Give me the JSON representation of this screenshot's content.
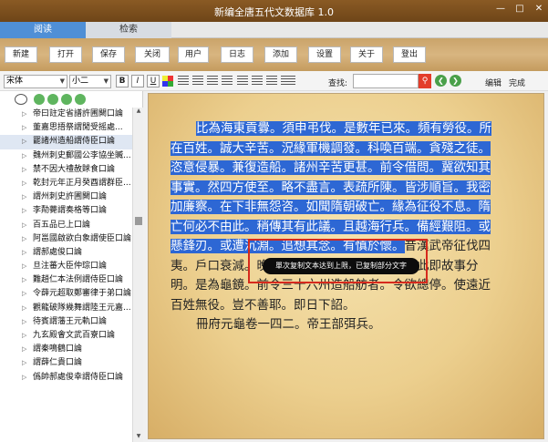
{
  "window": {
    "title": "新编全唐五代文数据库 1.0"
  },
  "tabs": [
    {
      "label": "阅读"
    },
    {
      "label": "检索"
    }
  ],
  "toolbar": {
    "buttons": [
      "新建",
      "打开",
      "保存",
      "关闭",
      "用户",
      "日志",
      "添加",
      "设置",
      "关于",
      "登出"
    ]
  },
  "format": {
    "font": "宋体",
    "size": "小二",
    "bold": "B",
    "italic": "I",
    "underline": "U",
    "search_label": "查找:",
    "search_value": "",
    "edit_label": "编辑",
    "done_label": "完成"
  },
  "sidebar": {
    "items": [
      "帝曰註定省譜許圃闕口論",
      "董嘉思捂祭謂閒受摇處...",
      "罷諸州造船謂侍臣口論",
      "魏州刺史郵國公李協坐贓...",
      "禁不因大禮赦賕食口論",
      "乾封元年正月癸酉謂群臣...",
      "謂州刺史許圃闕口論",
      "李勣薨謂奏格等口論",
      "百五品已上口論",
      "阿邕國啟欲白象謂使臣口論",
      "謂郝處俊口論",
      "旦注蕃大臣仲琮口論",
      "難趙仁本法例謂侍臣口論",
      "令薛元超取鄭審律于弟口論",
      "觀龍破隊幾舞謂陸王元嘉...",
      "待賓謂藩王元軌口論",
      "九玄殿會文武百寮口論",
      "謂秦鳴鶴口論",
      "謂薛仁貴口論",
      "僞帥郝處俊幸謂侍臣口論"
    ]
  },
  "reader": {
    "hl_lines": [
      "比為海東貢釁。須申弔伐。是數年已來。頻有勞役。所",
      "在百姓。誠大辛苦。況緣軍機調發。科喚百端。貪殘之徒。",
      "恣意侵暴。兼復造船。諸州辛苦更甚。前令借問。冀欲知其",
      "事實。然四方使至。略不盡言。表疏所陳。皆涉順旨。我密",
      "加廉察。在下非無怨咨。如聞隋朝破亡。緣為征役不息。隋",
      "亡何必不由此。稍傳其有此議。且越海行兵。備經艱阻。或"
    ],
    "line7_hl": "懸鋒刃。或遭沉淵。追想其念。有慎於懷。",
    "line7_rest": "昔漢武帝征伐四",
    "plain_lines": [
      "夷。戶口衰減。晚年感悟。封丞相為富民侯。此即故事分",
      "明。是為龜鏡。前令三十六州造船舫者。令欲總停。使遠近",
      "百姓無役。豈不善耶。即日下詔。"
    ],
    "source": "冊府元龜卷一四二。帝王部弭兵。"
  },
  "toast": {
    "message": "單次复制文本达到上限，已复制部分文字"
  }
}
